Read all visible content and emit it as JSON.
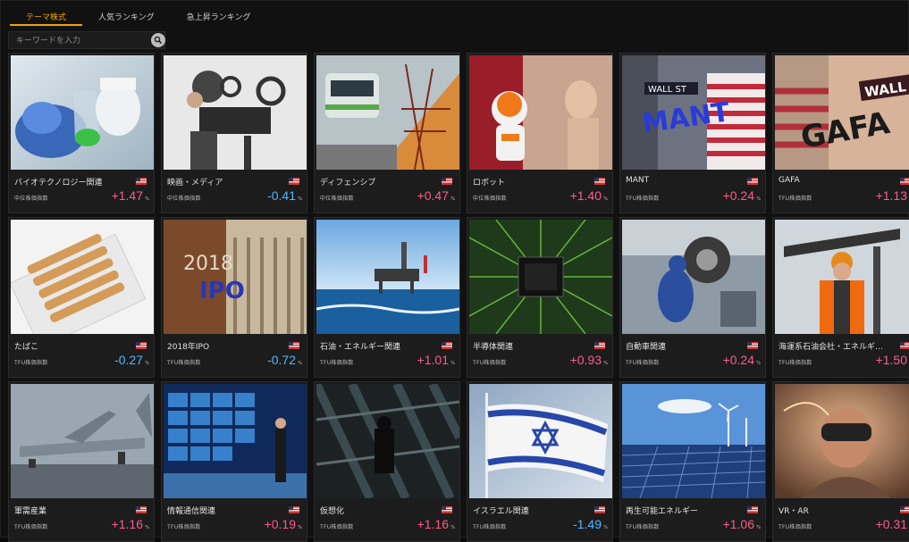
{
  "tabs": [
    "テーマ株式",
    "人気ランキング",
    "急上昇ランキング"
  ],
  "search": {
    "placeholder": "キーワードを入力"
  },
  "cards": [
    {
      "name": "バイオテクノロジー関連",
      "index": "中位株価指数",
      "change": "+1.47",
      "unit": "%",
      "dir": "pos",
      "flag": "us-flag-icon"
    },
    {
      "name": "映画・メディア",
      "index": "中位株価指数",
      "change": "-0.41",
      "unit": "%",
      "dir": "neg",
      "flag": "us-flag-icon"
    },
    {
      "name": "ディフェンシブ",
      "index": "中位株価指数",
      "change": "+0.47",
      "unit": "%",
      "dir": "pos",
      "flag": "us-flag-icon"
    },
    {
      "name": "ロボット",
      "index": "中位株価指数",
      "change": "+1.40",
      "unit": "%",
      "dir": "pos",
      "flag": "us-flag-icon"
    },
    {
      "name": "MANT",
      "index": "TFU株価指数",
      "change": "+0.24",
      "unit": "%",
      "dir": "pos",
      "flag": "us-flag-icon"
    },
    {
      "name": "GAFA",
      "index": "TFU株価指数",
      "change": "+1.13",
      "unit": "%",
      "dir": "pos",
      "flag": "us-flag-icon"
    },
    {
      "name": "たばこ",
      "index": "TFU株価指数",
      "change": "-0.27",
      "unit": "%",
      "dir": "neg",
      "flag": "us-flag-icon"
    },
    {
      "name": "2018年IPO",
      "index": "TFU株価指数",
      "change": "-0.72",
      "unit": "%",
      "dir": "neg",
      "flag": "us-flag-icon"
    },
    {
      "name": "石油・エネルギー関連",
      "index": "TFU株価指数",
      "change": "+1.01",
      "unit": "%",
      "dir": "pos",
      "flag": "us-flag-icon"
    },
    {
      "name": "半導体関連",
      "index": "TFU株価指数",
      "change": "+0.93",
      "unit": "%",
      "dir": "pos",
      "flag": "us-flag-icon"
    },
    {
      "name": "自動車関連",
      "index": "TFU株価指数",
      "change": "+0.24",
      "unit": "%",
      "dir": "pos",
      "flag": "us-flag-icon"
    },
    {
      "name": "海運系石油会社・エネルギ…",
      "index": "TFU株価指数",
      "change": "+1.50",
      "unit": "%",
      "dir": "pos",
      "flag": "us-flag-icon"
    },
    {
      "name": "軍需産業",
      "index": "TFU株価指数",
      "change": "+1.16",
      "unit": "%",
      "dir": "pos",
      "flag": "us-flag-icon"
    },
    {
      "name": "情報通信関連",
      "index": "TFU株価指数",
      "change": "+0.19",
      "unit": "%",
      "dir": "pos",
      "flag": "us-flag-icon"
    },
    {
      "name": "仮想化",
      "index": "TFU株価指数",
      "change": "+1.16",
      "unit": "%",
      "dir": "pos",
      "flag": "us-flag-icon"
    },
    {
      "name": "イスラエル関連",
      "index": "TFU株価指数",
      "change": "-1.49",
      "unit": "%",
      "dir": "neg",
      "flag": "us-flag-icon"
    },
    {
      "name": "再生可能エネルギー",
      "index": "TFU株価指数",
      "change": "+1.06",
      "unit": "%",
      "dir": "pos",
      "flag": "us-flag-icon"
    },
    {
      "name": "VR・AR",
      "index": "TFU株価指数",
      "change": "+0.31",
      "unit": "%",
      "dir": "pos",
      "flag": "us-flag-icon"
    }
  ],
  "thumb_labels": {
    "ipo_year": "2018",
    "ipo": "IPO",
    "mant": "MANT",
    "gafa": "GAFA",
    "wall_st": "WALL ST"
  },
  "colors": {
    "accent": "#f0a500",
    "positive": "#ff5b8a",
    "negative": "#4fb8ff"
  }
}
